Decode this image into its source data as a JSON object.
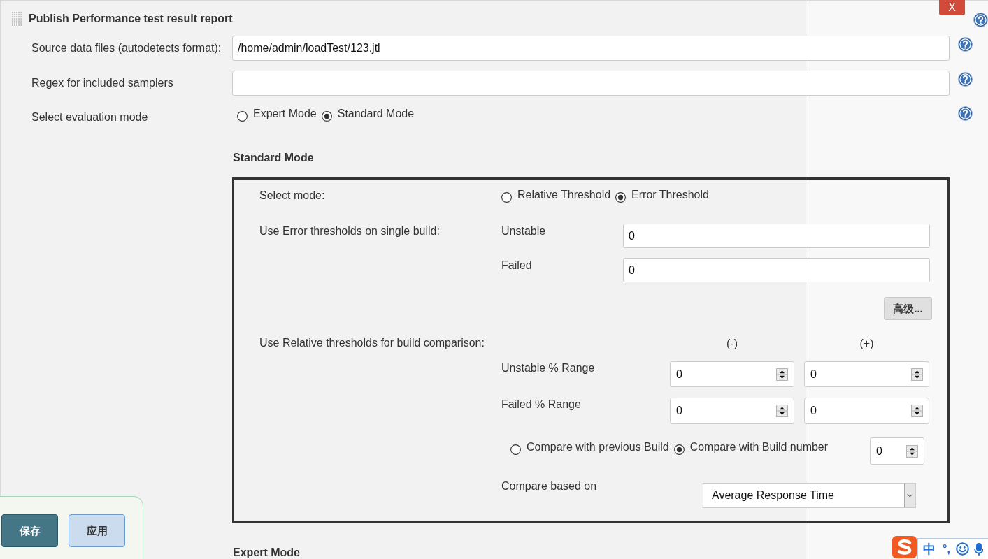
{
  "section": {
    "title": "Publish Performance test result report",
    "close_button": "X",
    "fields": [
      {
        "kind": "text",
        "label": "Source data files (autodetects format):",
        "value": "/home/admin/loadTest/123.jtl"
      },
      {
        "kind": "text",
        "label": "Regex for included samplers"
      },
      {
        "kind": "radio",
        "label": "Select evaluation mode",
        "options": [
          {
            "label": "Expert Mode",
            "selected": false
          },
          {
            "label": "Standard Mode",
            "selected": true
          }
        ]
      }
    ],
    "standard_mode": {
      "heading": "Standard Mode",
      "select_mode": {
        "label": "Select mode:",
        "options": [
          {
            "label": "Relative Threshold",
            "selected": false
          },
          {
            "label": "Error Threshold",
            "selected": true
          }
        ]
      },
      "error_thresholds": {
        "label": "Use Error thresholds on single build:",
        "fields": [
          {
            "label": "Unstable",
            "value": "0"
          },
          {
            "label": "Failed",
            "value": "0"
          }
        ]
      },
      "advanced_button": "高级...",
      "relative_thresholds": {
        "label": "Use Relative thresholds for build comparison:",
        "columns": [
          "(-)",
          "(+)"
        ],
        "rows": [
          {
            "label": "Unstable % Range",
            "values": [
              "0",
              "0"
            ]
          },
          {
            "label": "Failed % Range",
            "values": [
              "0",
              "0"
            ]
          }
        ]
      },
      "compare_with": {
        "options": [
          {
            "label": "Compare with previous Build",
            "selected": false
          },
          {
            "label": "Compare with Build number",
            "selected": true
          }
        ],
        "build_number": "0"
      },
      "compare_based_on": {
        "label": "Compare based on",
        "value": "Average Response Time"
      }
    },
    "expert_mode": {
      "heading": "Expert Mode"
    }
  },
  "bottom_bar": {
    "buttons": [
      {
        "label": "保存",
        "kind": "primary"
      },
      {
        "label": "应用",
        "kind": "secondary"
      }
    ]
  },
  "ime_toolbar": {
    "items": [
      "中",
      "°,"
    ]
  }
}
